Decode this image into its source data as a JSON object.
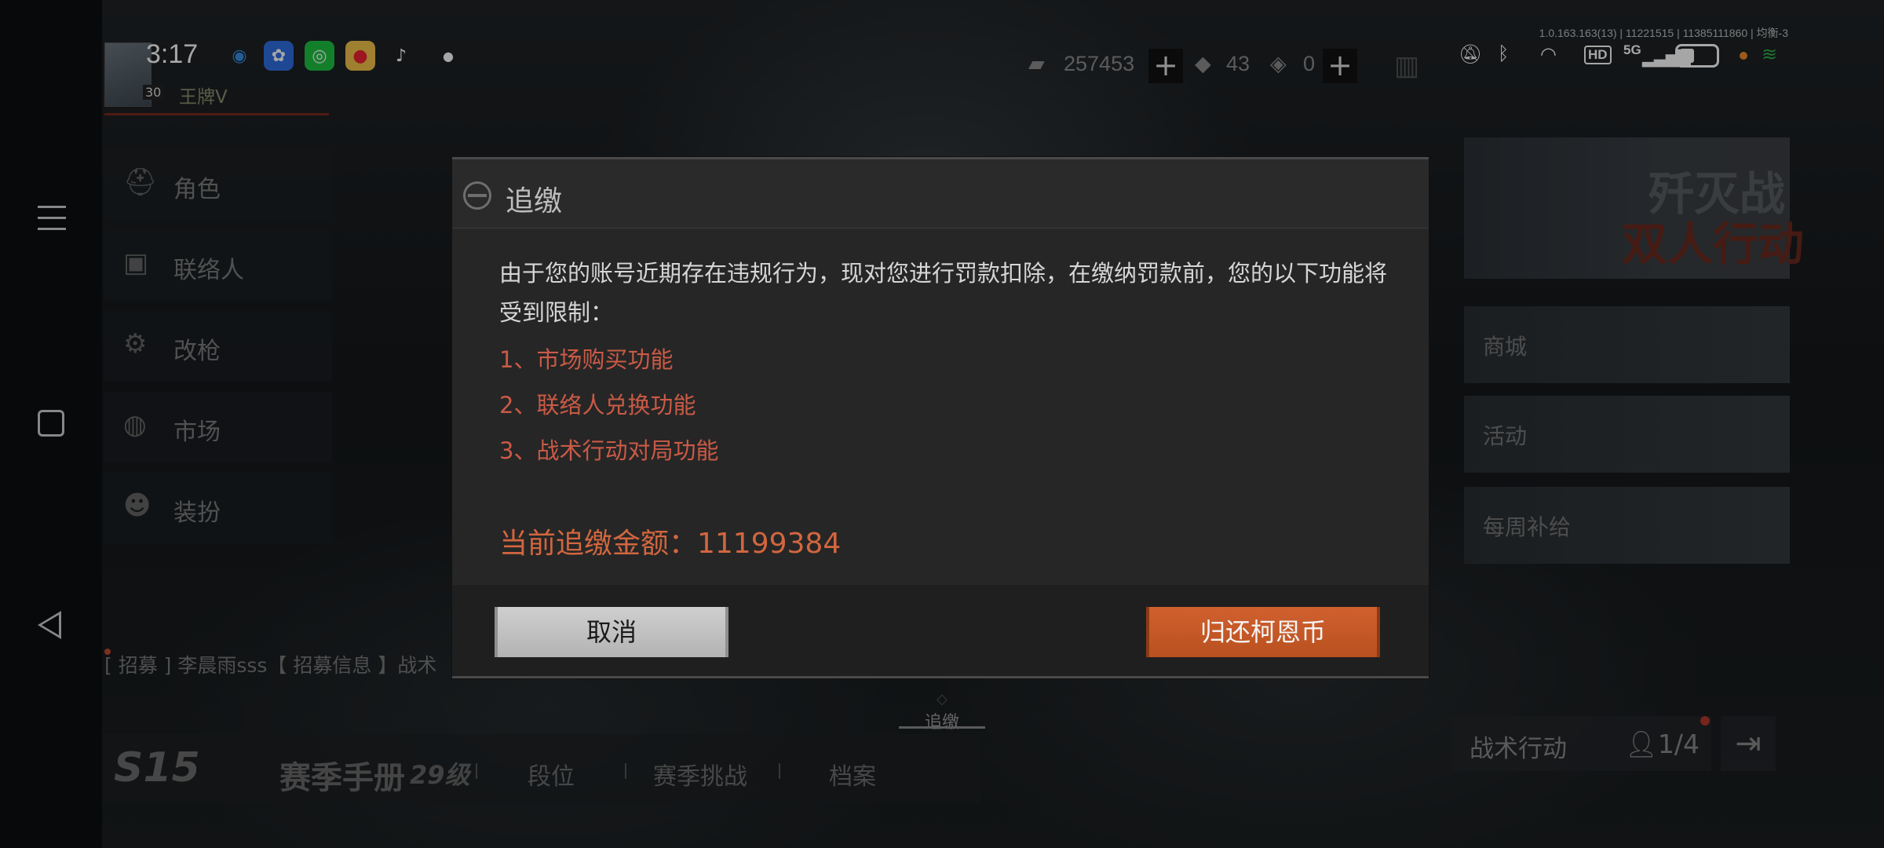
{
  "status_bar": {
    "time": "3:17",
    "version": "1.0.163.163(13) | 11221515 | 11385111860 | 均衡-3",
    "app_icons": [
      "qq-icon",
      "baidu-icon",
      "green-app-icon",
      "weibo-icon",
      "tiktok-icon"
    ],
    "system_icons": [
      "mute-icon",
      "bluetooth-icon",
      "wifi-icon",
      "hd-icon",
      "signal-5g-icon",
      "battery-icon"
    ],
    "hd_label": "HD",
    "net_label": "5G"
  },
  "player": {
    "level": "30",
    "rank": "王牌V"
  },
  "currency": {
    "coins": "257453",
    "tickets": "43",
    "vouchers": "0"
  },
  "left_menu": [
    {
      "label": "角色",
      "icon": "helmet-icon"
    },
    {
      "label": "联络人",
      "icon": "contact-icon"
    },
    {
      "label": "改枪",
      "icon": "gun-icon"
    },
    {
      "label": "市场",
      "icon": "market-icon"
    },
    {
      "label": "装扮",
      "icon": "outfit-icon"
    }
  ],
  "recruit_text": "[ 招募 ] 李晨雨sss【 招募信息 】战术",
  "bottom_bar": {
    "season": "S15",
    "manual": "赛季手册",
    "level": "29级",
    "tabs": [
      "段位",
      "赛季挑战",
      "档案"
    ]
  },
  "arrears_tab": "追缴",
  "right_panel": {
    "banner_line1": "歼灭战",
    "banner_line2": "双人行动",
    "cards": [
      "商城",
      "活动",
      "每周补给"
    ],
    "mode": "战术行动",
    "team_count": "1/4"
  },
  "dialog": {
    "title": "追缴",
    "message": "由于您的账号近期存在违规行为，现对您进行罚款扣除，在缴纳罚款前，您的以下功能将受到限制：",
    "restrictions": [
      "1、市场购买功能",
      "2、联络人兑换功能",
      "3、战术行动对局功能"
    ],
    "amount_label": "当前追缴金额：11199384",
    "cancel_label": "取消",
    "confirm_label": "归还柯恩币"
  },
  "colors": {
    "accent_orange": "#c9592f",
    "warning_red": "#c95a46",
    "dialog_bg": "#262626"
  }
}
